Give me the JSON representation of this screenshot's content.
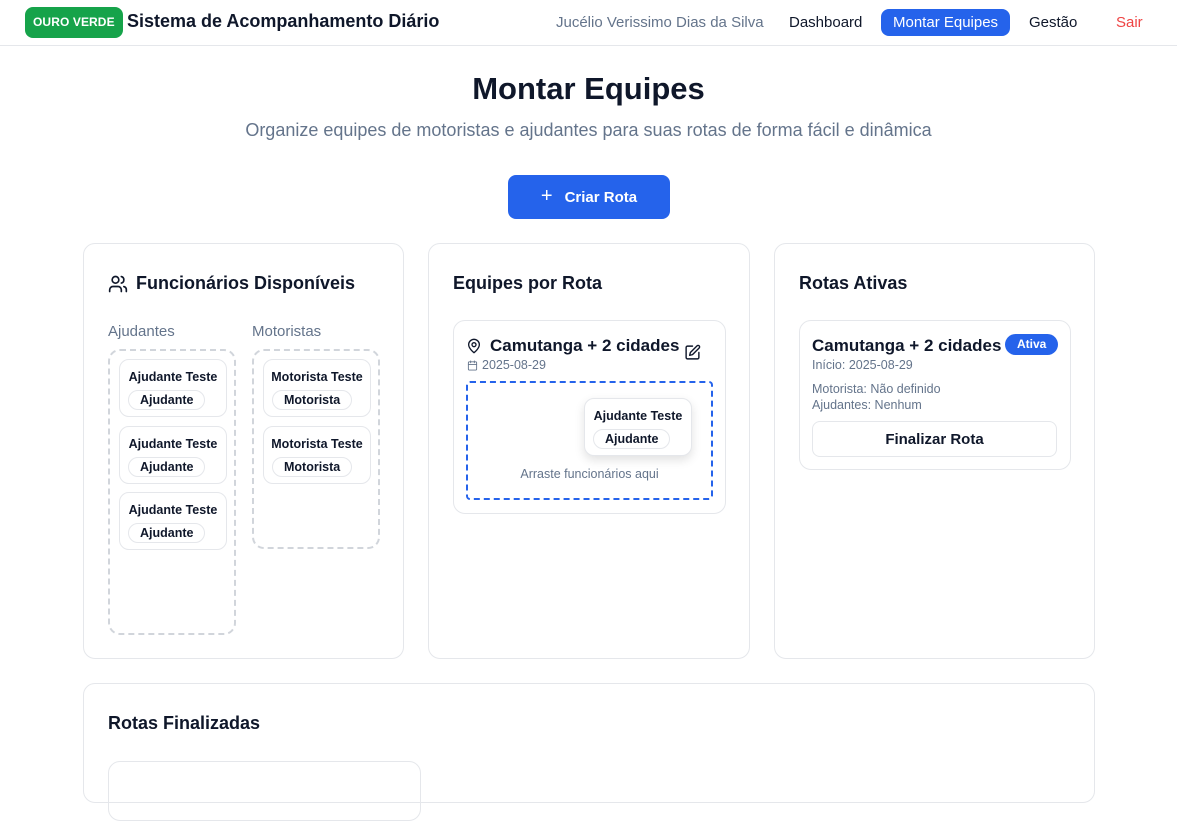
{
  "header": {
    "brand": "OURO VERDE",
    "title": "Sistema de Acompanhamento Diário",
    "user": "Jucélio Verissimo Dias da Silva",
    "nav": {
      "dashboard": "Dashboard",
      "montar_equipes": "Montar Equipes",
      "gestao": "Gestão",
      "sair": "Sair"
    },
    "active_nav": "Montar Equipes"
  },
  "hero": {
    "title": "Montar Equipes",
    "subtitle": "Organize equipes de motoristas e ajudantes para suas rotas de forma fácil e dinâmica",
    "create_button": "Criar Rota"
  },
  "funcionarios": {
    "title": "Funcionários Disponíveis",
    "ajudantes_label": "Ajudantes",
    "motoristas_label": "Motoristas",
    "ajudantes": [
      {
        "name": "Ajudante Teste",
        "role": "Ajudante"
      },
      {
        "name": "Ajudante Teste",
        "role": "Ajudante"
      },
      {
        "name": "Ajudante Teste",
        "role": "Ajudante"
      }
    ],
    "motoristas": [
      {
        "name": "Motorista Teste",
        "role": "Motorista"
      },
      {
        "name": "Motorista Teste",
        "role": "Motorista"
      }
    ]
  },
  "equipes": {
    "title": "Equipes por Rota",
    "route": {
      "name": "Camutanga + 2 cidades",
      "date": "2025-08-29",
      "drop_hint": "Arraste funcionários aqui",
      "dragging": {
        "name": "Ajudante Teste",
        "role": "Ajudante"
      }
    }
  },
  "ativas": {
    "title": "Rotas Ativas",
    "route": {
      "name": "Camutanga + 2 cidades",
      "badge": "Ativa",
      "inicio": "Início: 2025-08-29",
      "motorista": "Motorista: Não definido",
      "ajudantes": "Ajudantes: Nenhum",
      "finalize_button": "Finalizar Rota"
    }
  },
  "finalizadas": {
    "title": "Rotas Finalizadas"
  },
  "colors": {
    "brand_green": "#16a34a",
    "primary_blue": "#2563eb",
    "danger_red": "#ef4444",
    "muted": "#64748b"
  }
}
